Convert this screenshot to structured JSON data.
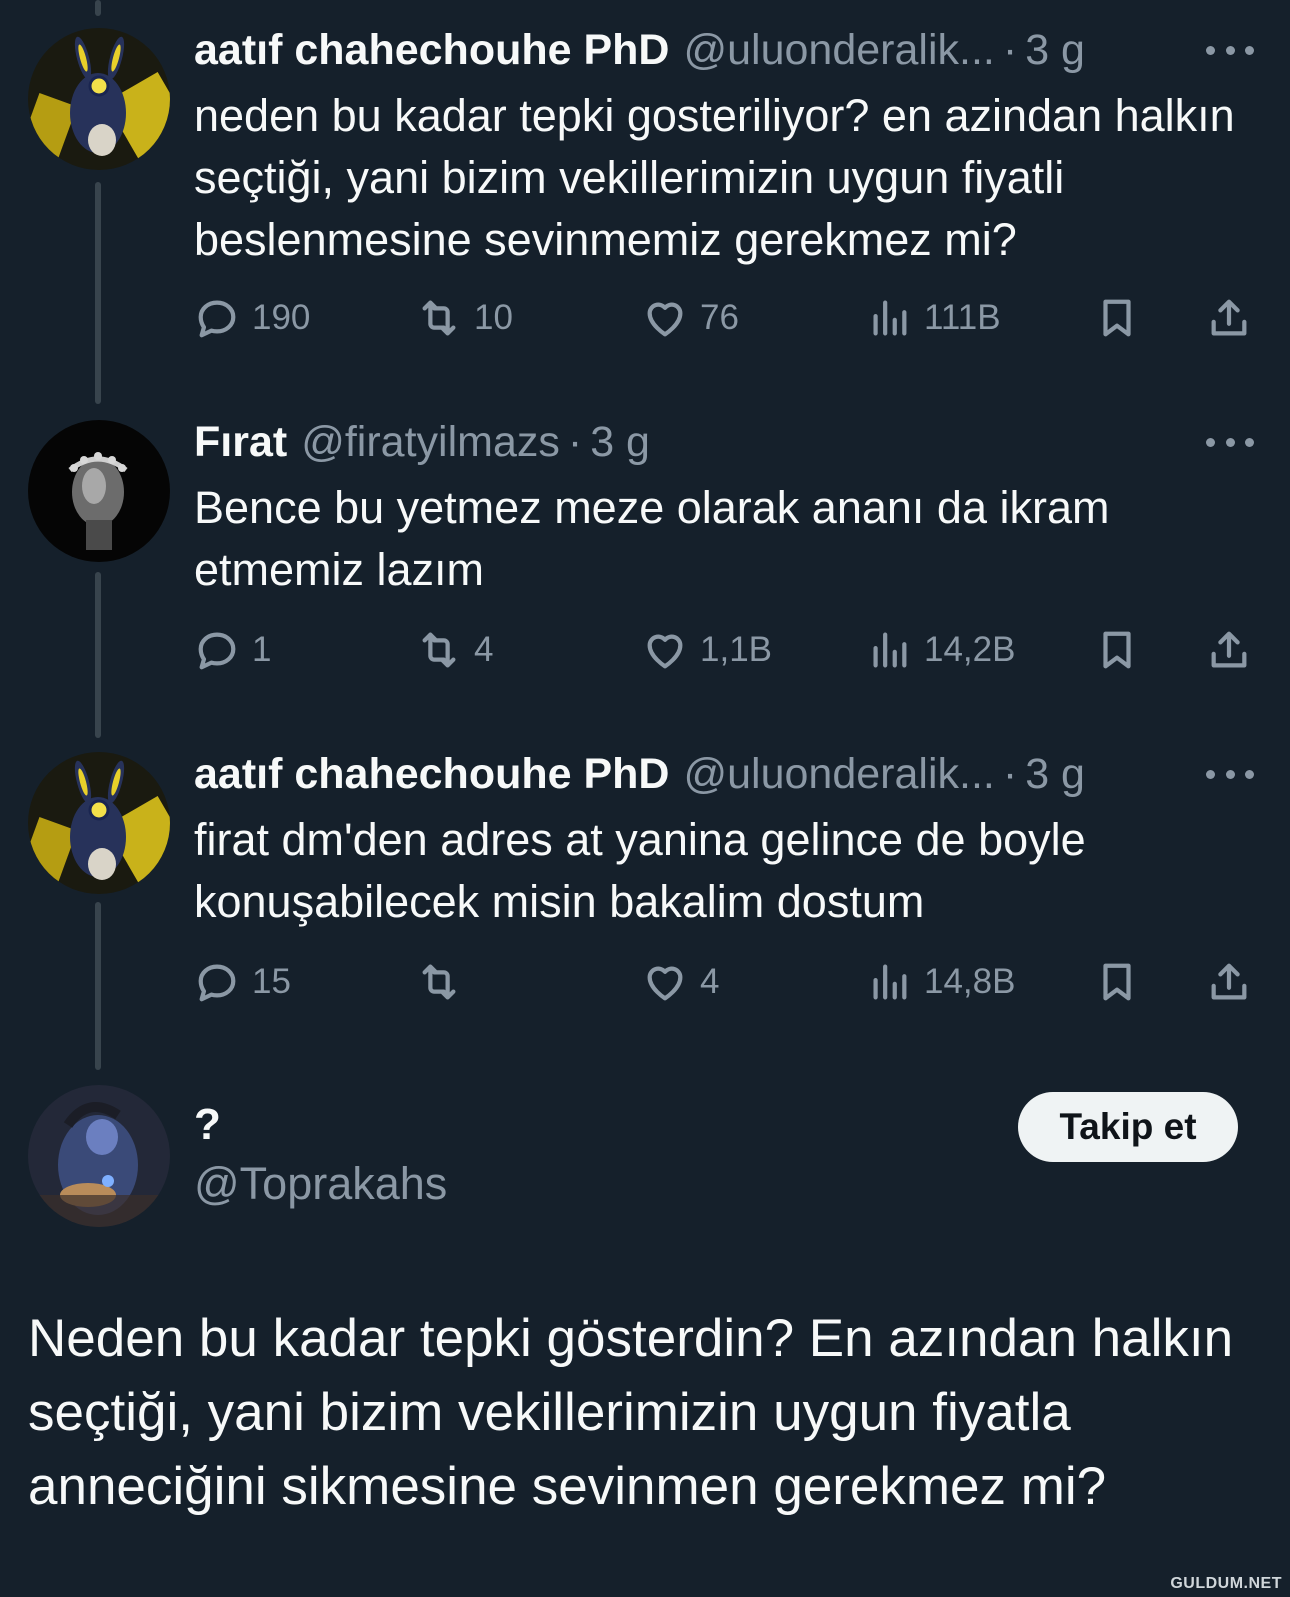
{
  "tweets": [
    {
      "name": "aatıf chahechouhe PhD",
      "handle": "@uluonderalik...",
      "time": "3 g",
      "text": "neden bu kadar tepki gosteriliyor? en azindan halkın seçtiği, yani bizim vekillerimizin uygun fiyatli beslenmesine sevinmemiz gerekmez mi?",
      "replies": "190",
      "retweets": "10",
      "likes": "76",
      "views": "111B"
    },
    {
      "name": "Fırat",
      "handle": "@firatyilmazs",
      "time": "3 g",
      "text": "Bence bu yetmez meze olarak ananı da ikram etmemiz lazım",
      "replies": "1",
      "retweets": "4",
      "likes": "1,1B",
      "views": "14,2B"
    },
    {
      "name": "aatıf chahechouhe PhD",
      "handle": "@uluonderalik...",
      "time": "3 g",
      "text": "firat dm'den adres at yanina gelince de boyle konuşabilecek misin bakalim dostum",
      "replies": "15",
      "retweets": "",
      "likes": "4",
      "views": "14,8B"
    }
  ],
  "separator": "·",
  "focus": {
    "name": "?",
    "handle": "@Toprakahs",
    "follow_label": "Takip et",
    "text": "Neden bu kadar tepki gösterdin? En azından halkın seçtiği, yani bizim vekillerimizin uygun fiyatla anneciğini sikmesine sevinmen gerekmez mi?"
  },
  "watermark": "GULDUM.NET",
  "colors": {
    "background": "#15202b",
    "text_primary": "#f7f9f9",
    "text_secondary": "#8b98a5",
    "thread_line": "#38444d",
    "follow_button_bg": "#eff3f4"
  }
}
